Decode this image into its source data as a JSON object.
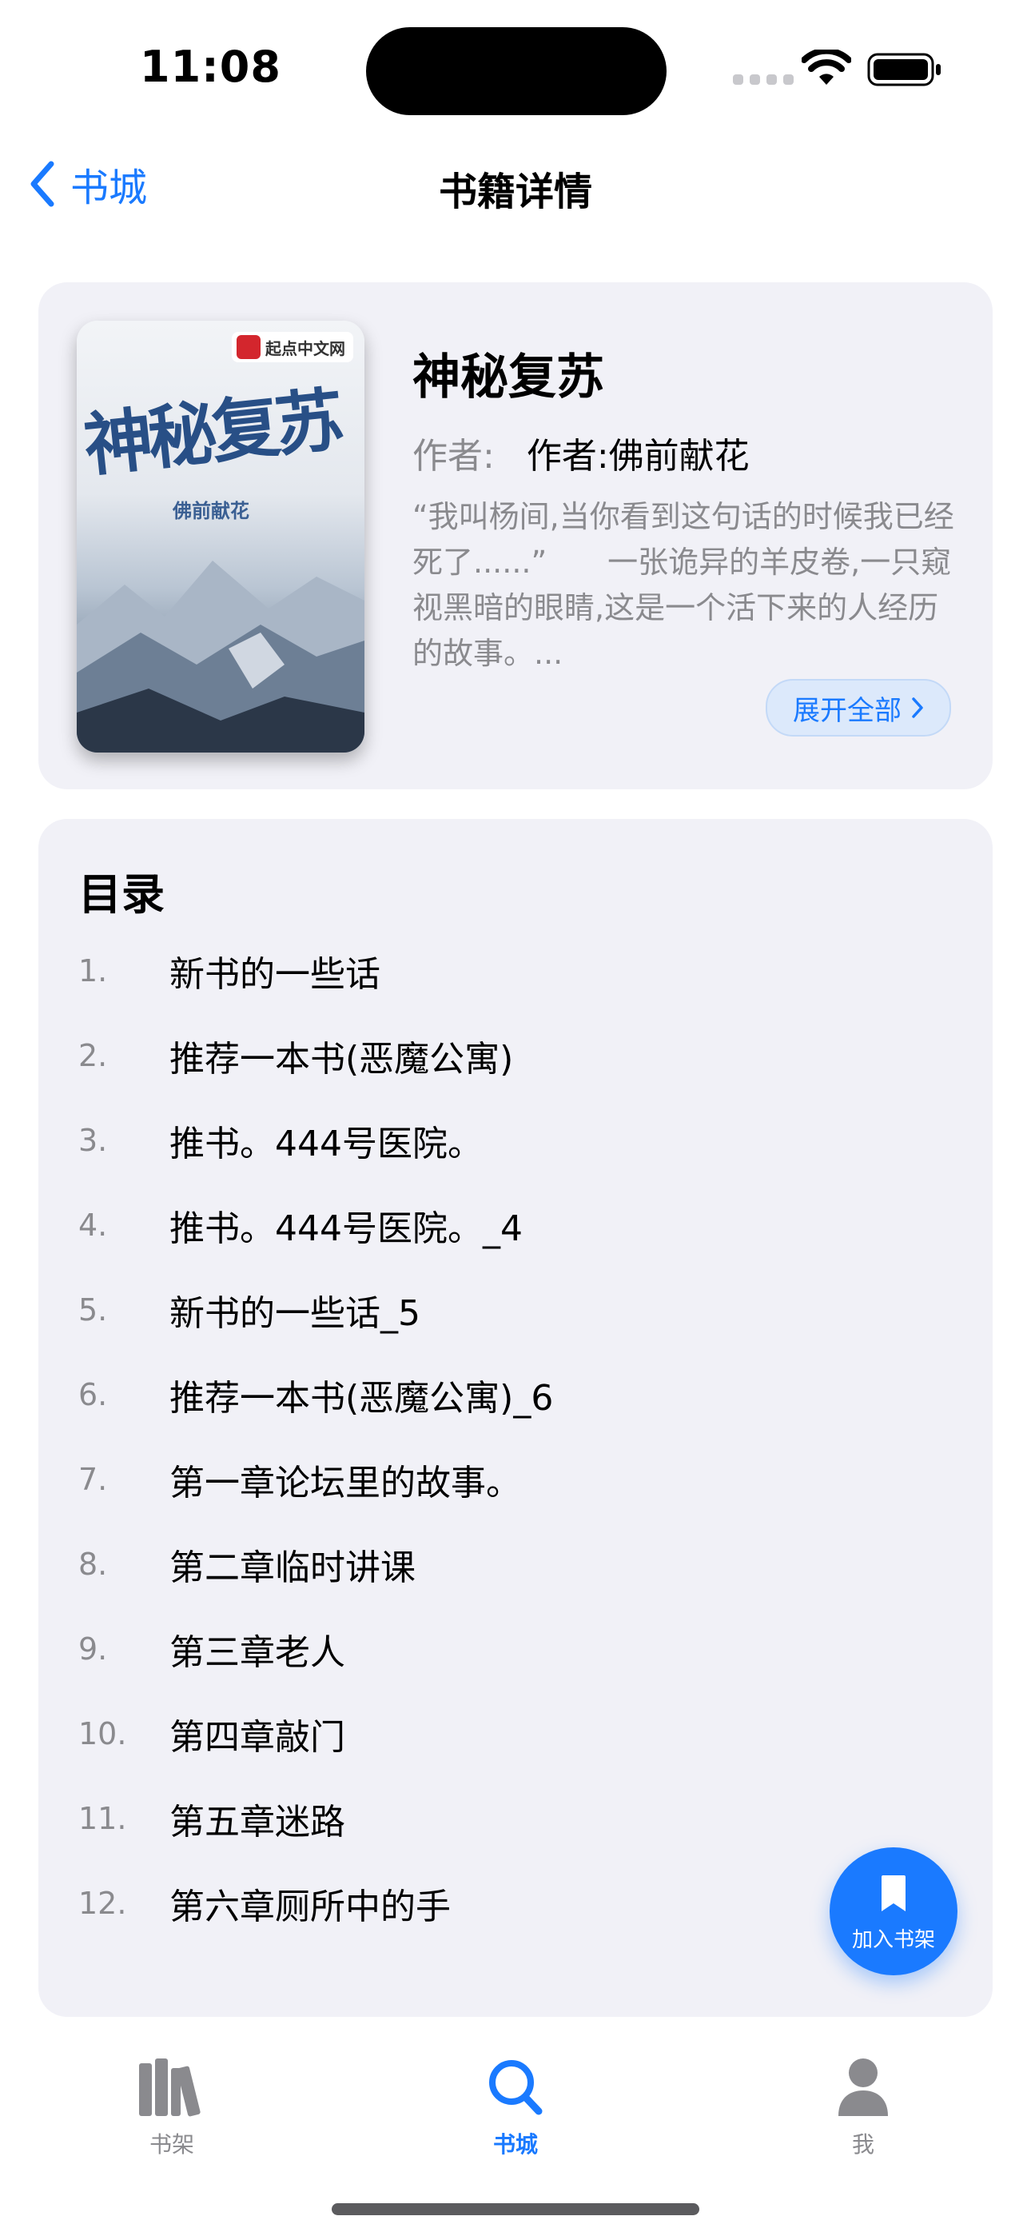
{
  "status_bar": {
    "time": "11:08"
  },
  "nav": {
    "back_label": "书城",
    "title": "书籍详情"
  },
  "book": {
    "cover": {
      "badge": "起点中文网",
      "title": "神秘复苏",
      "author": "佛前献花"
    },
    "title": "神秘复苏",
    "author_key": "作者:",
    "author_value": "作者:佛前献花",
    "description": "“我叫杨间,当你看到这句话的时候我已经死了......”　　一张诡异的羊皮卷,一只窥视黑暗的眼睛,这是一个活下来的人经历的故事。...",
    "expand_label": "展开全部"
  },
  "toc": {
    "heading": "目录",
    "items": [
      {
        "num": "1.",
        "title": "新书的一些话"
      },
      {
        "num": "2.",
        "title": "推荐一本书(恶魔公寓)"
      },
      {
        "num": "3.",
        "title": "推书。444号医院。"
      },
      {
        "num": "4.",
        "title": "推书。444号医院。_4"
      },
      {
        "num": "5.",
        "title": "新书的一些话_5"
      },
      {
        "num": "6.",
        "title": "推荐一本书(恶魔公寓)_6"
      },
      {
        "num": "7.",
        "title": "第一章论坛里的故事。"
      },
      {
        "num": "8.",
        "title": "第二章临时讲课"
      },
      {
        "num": "9.",
        "title": "第三章老人"
      },
      {
        "num": "10.",
        "title": "第四章敲门"
      },
      {
        "num": "11.",
        "title": "第五章迷路"
      },
      {
        "num": "12.",
        "title": "第六章厕所中的手"
      }
    ]
  },
  "fab": {
    "label": "加入书架",
    "icon": "bookmark-icon"
  },
  "tabs": [
    {
      "label": "书架",
      "icon": "books-icon",
      "active": false
    },
    {
      "label": "书城",
      "icon": "search-icon",
      "active": true
    },
    {
      "label": "我",
      "icon": "person-icon",
      "active": false
    }
  ],
  "colors": {
    "accent": "#1a7aff",
    "card_bg": "#f1f1f7",
    "secondary_text": "#8a8a8e"
  }
}
